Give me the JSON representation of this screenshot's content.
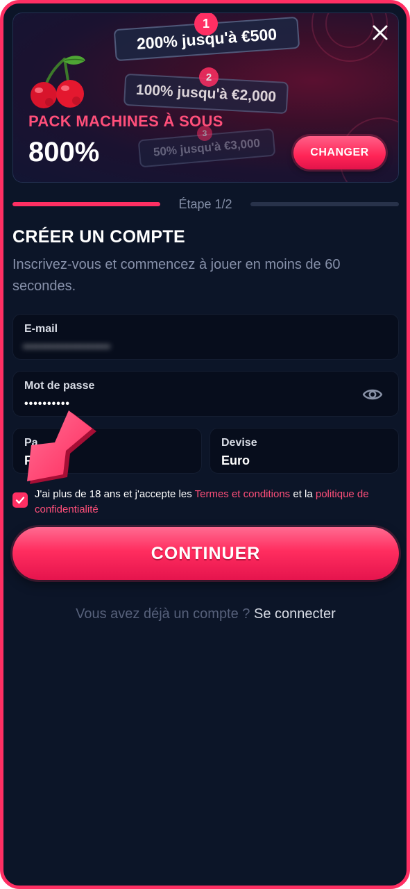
{
  "colors": {
    "accent": "#ff2f63",
    "background": "#0c1528",
    "field_background": "#070d1c",
    "link": "#ff4f7a"
  },
  "banner": {
    "close_icon": "close-icon",
    "tiers": [
      {
        "number": "1",
        "label": "200% jusqu'à €500"
      },
      {
        "number": "2",
        "label": "100% jusqu'à €2,000"
      },
      {
        "number": "3",
        "label": "50% jusqu'à €3,000"
      }
    ],
    "pack_title": "PACK MACHINES À SOUS",
    "pack_percent": "800%",
    "change_label": "CHANGER"
  },
  "progress": {
    "step_label": "Étape 1/2",
    "current_step": 1,
    "total_steps": 2
  },
  "form": {
    "title": "CRÉER UN COMPTE",
    "subtitle": "Inscrivez-vous et commencez à jouer en moins de 60 secondes.",
    "email": {
      "label": "E-mail",
      "value_blurred": "••••••••••••••••••••"
    },
    "password": {
      "label": "Mot de passe",
      "value": "••••••••••",
      "eye_icon": "eye-icon"
    },
    "country": {
      "label": "Pa",
      "value": "F"
    },
    "currency": {
      "label": "Devise",
      "value": "Euro"
    },
    "terms": {
      "checked": true,
      "text_before": "J'ai plus de 18 ans et j'accepte les ",
      "terms_link": "Termes et conditions",
      "text_middle": " et la ",
      "privacy_link": "politique de confidentialité"
    },
    "continue_label": "CONTINUER"
  },
  "login": {
    "prompt": "Vous avez déjà un compte ? ",
    "link": "Se connecter"
  }
}
